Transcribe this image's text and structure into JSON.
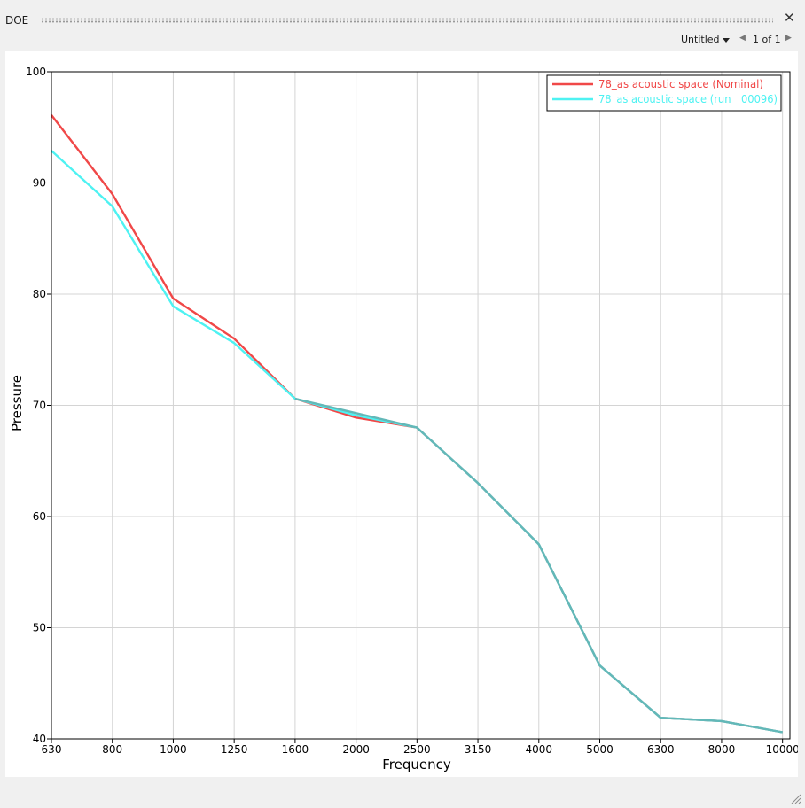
{
  "window": {
    "title": "DOE",
    "close_glyph": "✕"
  },
  "toolbar": {
    "page_name": "Untitled",
    "page_info": "1 of 1"
  },
  "icons": {
    "close": "close-icon",
    "prev": "chevron-left-icon",
    "next": "chevron-right-icon",
    "dropdown": "caret-down-icon",
    "resize": "resize-grip-icon"
  },
  "colors": {
    "nominal": "#f04848",
    "run": "#4ef2f2",
    "overlap": "#63b8b8"
  },
  "chart_data": {
    "type": "line",
    "xlabel": "Frequency",
    "ylabel": "Pressure",
    "categories": [
      "630",
      "800",
      "1000",
      "1250",
      "1600",
      "2000",
      "2500",
      "3150",
      "4000",
      "5000",
      "6300",
      "8000",
      "10000"
    ],
    "ylim": [
      40,
      100
    ],
    "yticks": [
      "40",
      "50",
      "60",
      "70",
      "80",
      "90",
      "100"
    ],
    "grid": true,
    "legend_position": "top-right",
    "series": [
      {
        "name": "78_as acoustic space (Nominal)",
        "color": "#f04848",
        "values": [
          96.1,
          89.0,
          79.6,
          76.0,
          70.6,
          68.9,
          68.0,
          63.0,
          57.5,
          46.6,
          41.9,
          41.6,
          40.6
        ]
      },
      {
        "name": "78_as acoustic space (run__00096)",
        "color": "#4ef2f2",
        "values": [
          92.9,
          87.9,
          78.9,
          75.6,
          70.6,
          69.1,
          68.0,
          63.0,
          57.5,
          46.6,
          41.9,
          41.6,
          40.6
        ]
      }
    ]
  }
}
